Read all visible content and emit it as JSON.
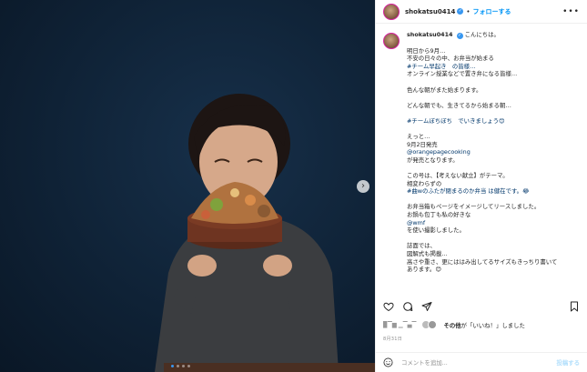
{
  "post": {
    "username": "shokatsu0414",
    "follow_label": "フォローする",
    "separator": "•",
    "more_label": "•••",
    "caption_lines": [
      "明日から9月…",
      "不安の日々の中、お弁当が始まる",
      "#チーム早起き　の皆様…",
      "オンライン授業などで置き弁になる皆様…",
      "",
      "色んな朝がまた始まります。",
      "",
      "どんな朝でも、生きてるから始まる朝…",
      "",
      "#チームぼちぼち　でいきましょう😊",
      "",
      "えっと…",
      "9月2日発売",
      "@orangepagecooking",
      "が発売となります。",
      "",
      "この号は、【考えない献立】がテーマ。",
      "相変わらずの",
      "#曲wのふたが閉まるのか弁当 は健在です。😂",
      "",
      "お弁当箱もページをイメージしてリースしました。",
      "お鍋も包丁も私の好きな",
      "@wmf",
      "を使い撮影しました。",
      "",
      "誌面では、",
      "図解式も掲載…",
      "高さや重さ、更にははみ出してるサイズもきっちり書いて",
      "あります。😊"
    ],
    "caption_first": "こんにちは。",
    "likes_other": "その他",
    "likes_text": "が「いいね！」しました",
    "likes_name": "▉▔▆ ▁▔▄▔",
    "date": "8月31日",
    "comment_placeholder": "コメントを追加...",
    "post_label": "投稿する"
  },
  "colors": {
    "accent": "#0095f6",
    "link": "#00376b",
    "verified": "#3897f0",
    "post_disabled": "#b2dffc"
  },
  "carousel": {
    "count": 4,
    "active_index": 0
  }
}
